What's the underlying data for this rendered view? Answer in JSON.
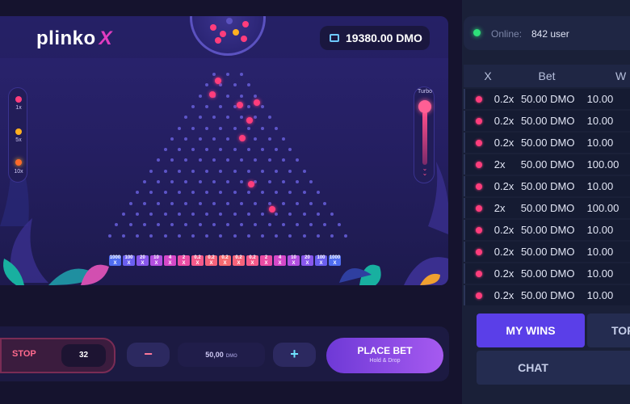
{
  "game": {
    "logo_text": "plinko",
    "logo_x": "X",
    "balance": "19380.00 DMO",
    "risk_levels": [
      "1x",
      "5x",
      "10x"
    ],
    "turbo_label": "Turbo",
    "multipliers": [
      {
        "top": "1000",
        "bottom": "X",
        "color": "#4f6df0"
      },
      {
        "top": "100",
        "bottom": "X",
        "color": "#6a5ff0"
      },
      {
        "top": "20",
        "bottom": "X",
        "color": "#8857ec"
      },
      {
        "top": "10",
        "bottom": "X",
        "color": "#b24fe0"
      },
      {
        "top": "4",
        "bottom": "X",
        "color": "#d448c8"
      },
      {
        "top": "2",
        "bottom": "X",
        "color": "#ea4ca4"
      },
      {
        "top": "0.2",
        "bottom": "X",
        "color": "#f45a8a"
      },
      {
        "top": "0.2",
        "bottom": "X",
        "color": "#f5637a"
      },
      {
        "top": "0.2",
        "bottom": "X",
        "color": "#f56a70"
      },
      {
        "top": "0.2",
        "bottom": "X",
        "color": "#f5637a"
      },
      {
        "top": "0.2",
        "bottom": "X",
        "color": "#f45a8a"
      },
      {
        "top": "2",
        "bottom": "X",
        "color": "#ea4ca4"
      },
      {
        "top": "4",
        "bottom": "X",
        "color": "#d448c8"
      },
      {
        "top": "10",
        "bottom": "X",
        "color": "#b24fe0"
      },
      {
        "top": "20",
        "bottom": "X",
        "color": "#8857ec"
      },
      {
        "top": "100",
        "bottom": "X",
        "color": "#6a5ff0"
      },
      {
        "top": "1000",
        "bottom": "X",
        "color": "#4f6df0"
      }
    ]
  },
  "controls": {
    "stop_label": "STOP",
    "stop_value": "32",
    "minus_label": "−",
    "amount": "50,00",
    "amount_unit": "DMO",
    "plus_label": "+",
    "place_bet_label": "PLACE BET",
    "place_bet_sub": "Hold & Drop"
  },
  "sidebar": {
    "online_label": "Online:",
    "online_count": "842 user",
    "table_headers": [
      "X",
      "Bet",
      "W"
    ],
    "rows": [
      {
        "x": "0.2x",
        "bet": "50.00 DMO",
        "win": "10.00"
      },
      {
        "x": "0.2x",
        "bet": "50.00 DMO",
        "win": "10.00"
      },
      {
        "x": "0.2x",
        "bet": "50.00 DMO",
        "win": "10.00"
      },
      {
        "x": "2x",
        "bet": "50.00 DMO",
        "win": "100.00"
      },
      {
        "x": "0.2x",
        "bet": "50.00 DMO",
        "win": "10.00"
      },
      {
        "x": "2x",
        "bet": "50.00 DMO",
        "win": "100.00"
      },
      {
        "x": "0.2x",
        "bet": "50.00 DMO",
        "win": "10.00"
      },
      {
        "x": "0.2x",
        "bet": "50.00 DMO",
        "win": "10.00"
      },
      {
        "x": "0.2x",
        "bet": "50.00 DMO",
        "win": "10.00"
      },
      {
        "x": "0.2x",
        "bet": "50.00 DMO",
        "win": "10.00"
      }
    ],
    "tab_mywins": "MY WINS",
    "tab_top": "TOP",
    "tab_chat": "CHAT"
  },
  "colors": {
    "accent_pink": "#ff3d7c",
    "accent_purple": "#5a3fe8",
    "online_green": "#2ee07a"
  }
}
